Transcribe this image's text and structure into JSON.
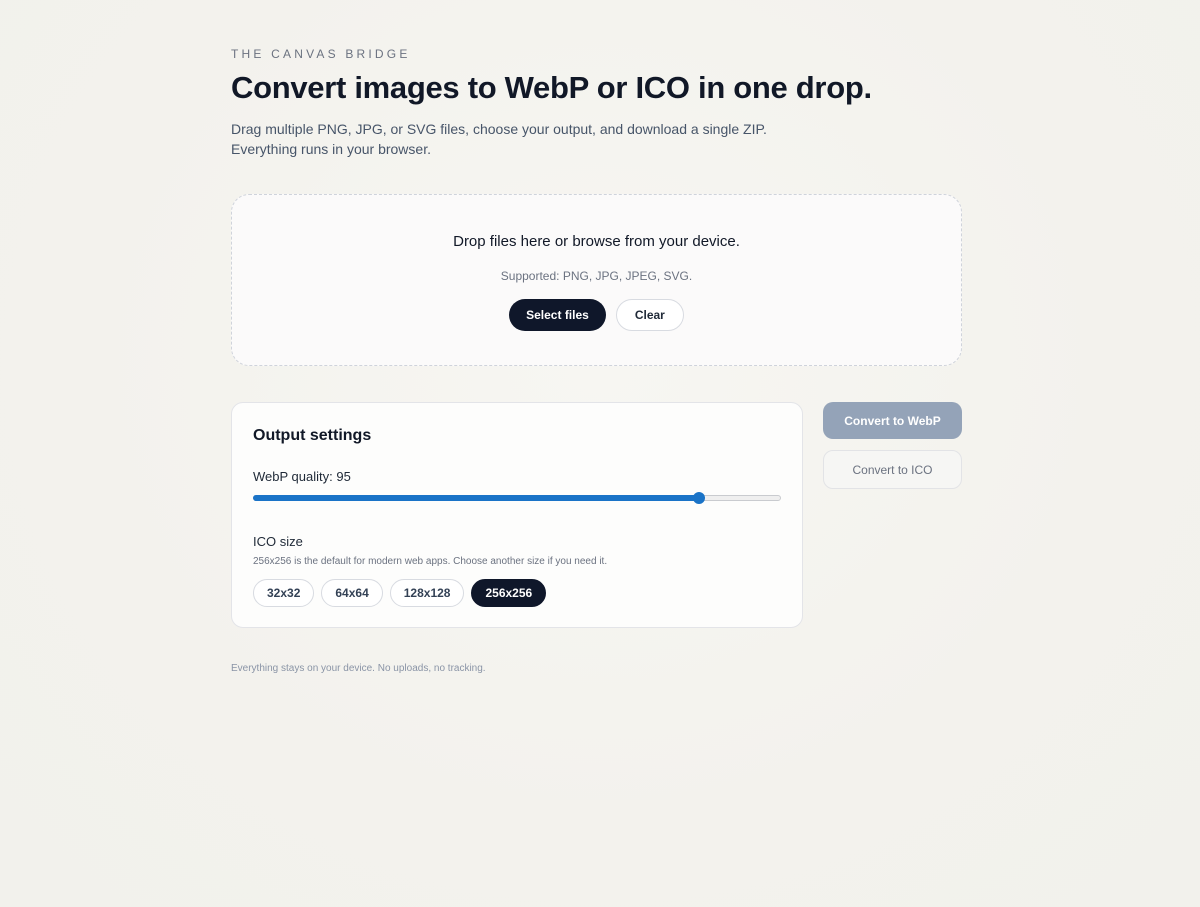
{
  "header": {
    "eyebrow": "THE CANVAS BRIDGE",
    "title": "Convert images to WebP or ICO in one drop.",
    "subtitle_lines": [
      "Drag multiple PNG, JPG, or SVG files, choose your output, and download a single ZIP.",
      "Everything runs in your browser."
    ]
  },
  "dropzone": {
    "title": "Drop files here or browse from your device.",
    "supported": "Supported: PNG, JPG, JPEG, SVG.",
    "select_label": "Select files",
    "clear_label": "Clear"
  },
  "settings": {
    "title": "Output settings",
    "quality_label": "WebP quality: 95",
    "quality_value": 95,
    "quality_min": 0,
    "quality_max": 100,
    "ico_label": "ICO size",
    "ico_hint": "256x256 is the default for modern web apps. Choose another size if you need it.",
    "sizes": [
      "32x32",
      "64x64",
      "128x128",
      "256x256"
    ],
    "selected_size": "256x256"
  },
  "actions": {
    "convert_webp": "Convert to WebP",
    "convert_ico": "Convert to ICO"
  },
  "footer": {
    "note": "Everything stays on your device. No uploads, no tracking."
  },
  "colors": {
    "background": "#f4f3ee",
    "primary_dark": "#0f172a",
    "slider_accent": "#1a73c7",
    "disabled_button": "#94a3b8"
  }
}
